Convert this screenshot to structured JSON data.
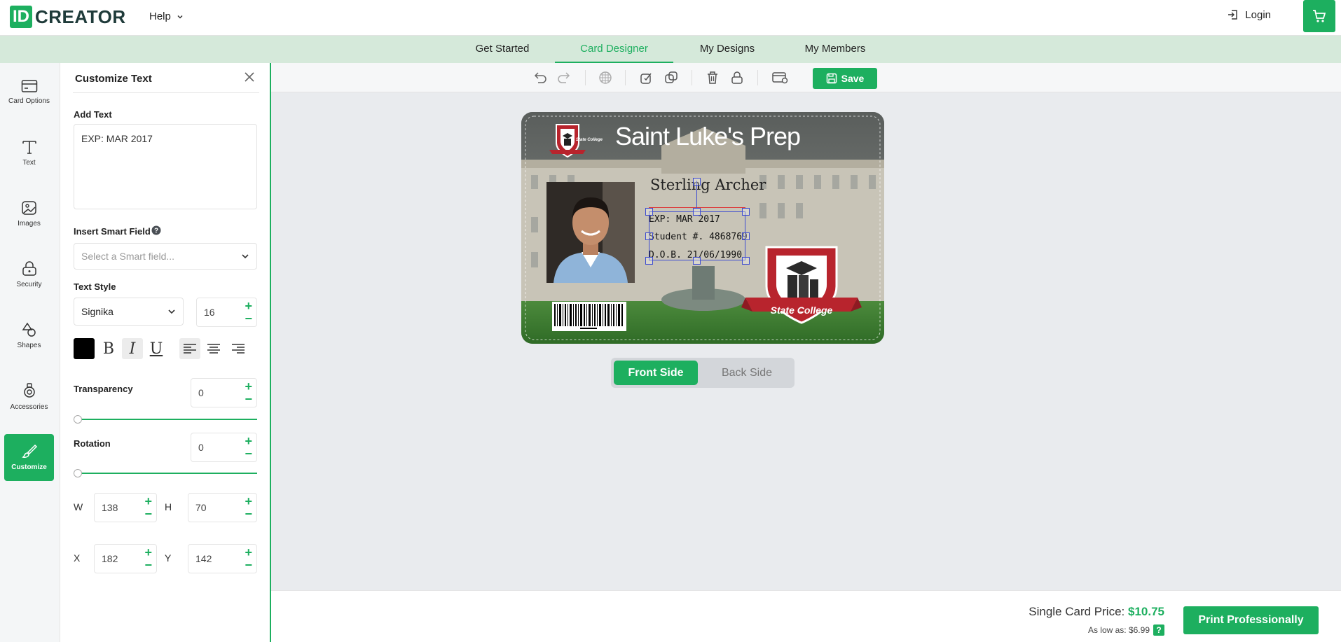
{
  "header": {
    "logo_id": "ID",
    "logo_text": "CREATOR",
    "help_label": "Help",
    "login_label": "Login"
  },
  "nav": {
    "tabs": [
      {
        "label": "Get Started"
      },
      {
        "label": "Card Designer"
      },
      {
        "label": "My Designs"
      },
      {
        "label": "My Members"
      }
    ],
    "active": "Card Designer"
  },
  "rail": {
    "items": [
      {
        "label": "Card Options",
        "icon": "card-icon"
      },
      {
        "label": "Text",
        "icon": "text-icon"
      },
      {
        "label": "Images",
        "icon": "image-icon"
      },
      {
        "label": "Security",
        "icon": "lock-icon"
      },
      {
        "label": "Shapes",
        "icon": "shapes-icon"
      },
      {
        "label": "Accessories",
        "icon": "accessory-icon"
      },
      {
        "label": "Customize",
        "icon": "brush-icon"
      }
    ],
    "active": "Customize"
  },
  "panel": {
    "title": "Customize Text",
    "add_text_label": "Add Text",
    "add_text_value": "EXP: MAR 2017",
    "smart_field_label": "Insert Smart Field",
    "smart_field_placeholder": "Select a Smart field...",
    "text_style_label": "Text Style",
    "font_value": "Signika",
    "font_size": "16",
    "text_color": "#000000",
    "transparency_label": "Transparency",
    "transparency_value": "0",
    "rotation_label": "Rotation",
    "rotation_value": "0",
    "w_label": "W",
    "w_value": "138",
    "h_label": "H",
    "h_value": "70",
    "x_label": "X",
    "x_value": "182",
    "y_label": "Y",
    "y_value": "142"
  },
  "toolbar": {
    "save_label": "Save"
  },
  "card": {
    "title": "Saint Luke's Prep",
    "name": "Sterling Archer",
    "line1": "EXP: MAR 2017",
    "line2": "Student #. 4868769",
    "line3": "D.O.B. 21/06/1990",
    "seal_text": "State College"
  },
  "side_toggle": {
    "front": "Front Side",
    "back": "Back Side"
  },
  "footer": {
    "price_label": "Single Card Price:",
    "price_value": "$10.75",
    "low_label": "As low as: $6.99",
    "help_badge": "?",
    "print_label": "Print Professionally"
  },
  "colors": {
    "accent": "#1daf5f",
    "nav_bg": "#d5e9da"
  }
}
